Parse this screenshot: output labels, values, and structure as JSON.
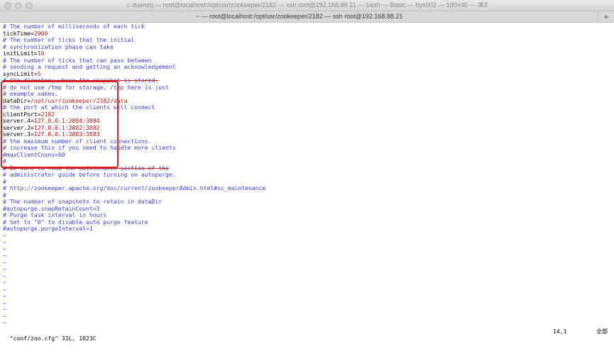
{
  "window": {
    "title": "duanzq — root@localhost:/opt/usr/zookeeper/2182 — ssh root@192.168.88.21 — bash — Basic — ttys002 — 180×46 — ⌘3",
    "home_glyph": "⌂",
    "tab_label": "~ — root@localhost:/opt/usr/zookeeper/2182 — ssh root@192.168.88.21",
    "add_tab_glyph": "+"
  },
  "editor": {
    "tilde_glyph": "~",
    "lines": [
      {
        "type": "comment",
        "text": "# The number of milliseconds of each tick"
      },
      {
        "type": "kv",
        "key": "tickTime",
        "value": "2000"
      },
      {
        "type": "comment",
        "text": "# The number of ticks that the initial"
      },
      {
        "type": "comment",
        "text": "# synchronization phase can take"
      },
      {
        "type": "kv",
        "key": "initLimit",
        "value": "10"
      },
      {
        "type": "comment",
        "text": "# The number of ticks that can pass between"
      },
      {
        "type": "comment",
        "text": "# sending a request and getting an acknowledgement"
      },
      {
        "type": "kv",
        "key": "syncLimit",
        "value": "5"
      },
      {
        "type": "comment-strike",
        "text": "# the directory where the snapshot is stored."
      },
      {
        "type": "comment",
        "text": "# do not use /tmp for storage, /tmp here is just"
      },
      {
        "type": "comment",
        "text": "# example sakes."
      },
      {
        "type": "kv",
        "key": "dataDir",
        "value": "/opt/usr/zookeeper/2182/data"
      },
      {
        "type": "comment",
        "text": "# the port at which the clients will connect"
      },
      {
        "type": "kv",
        "key": "clientPort",
        "value": "2182"
      },
      {
        "type": "kv",
        "key": "server.4",
        "value": "127.0.0.1:2884:3884"
      },
      {
        "type": "kv",
        "key": "server.2",
        "value": "127.0.0.1:2882:3882"
      },
      {
        "type": "kv",
        "key": "server.3",
        "value": "127.0.0.1:2883:3883"
      },
      {
        "type": "comment",
        "text": "# the maximum number of client connections."
      },
      {
        "type": "comment",
        "text": "# increase this if you need to handle more clients"
      },
      {
        "type": "comment",
        "text": "#maxClientCnxns=60"
      },
      {
        "type": "comment",
        "text": "#"
      },
      {
        "type": "comment-strike",
        "text": "# Be sure to read the maintenance section of the"
      },
      {
        "type": "comment",
        "text": "# administrator guide before turning on autopurge."
      },
      {
        "type": "comment",
        "text": "#"
      },
      {
        "type": "comment",
        "text": "# http://zookeeper.apache.org/doc/current/zookeeperAdmin.html#sc_maintenance"
      },
      {
        "type": "comment",
        "text": "#"
      },
      {
        "type": "comment",
        "text": "# The number of snapshots to retain in dataDir"
      },
      {
        "type": "comment",
        "text": "#autopurge.snapRetainCount=3"
      },
      {
        "type": "comment",
        "text": "# Purge task interval in hours"
      },
      {
        "type": "comment",
        "text": "# Set to \"0\" to disable auto purge feature"
      },
      {
        "type": "comment",
        "text": "#autopurge.purgeInterval=1"
      }
    ],
    "tilde_count": 14
  },
  "status": {
    "file_info": "\"conf/zoo.cfg\" 31L, 1023C",
    "position": "14,1",
    "scroll": "全部"
  },
  "colors": {
    "comment": "#3d3de0",
    "value": "#c01818",
    "highlight_box": "#e02020"
  }
}
